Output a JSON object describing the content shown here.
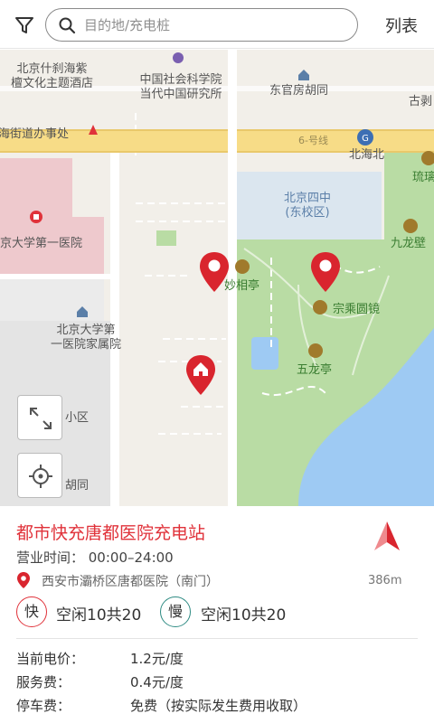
{
  "search": {
    "placeholder": "目的地/充电桩"
  },
  "header": {
    "list_label": "列表"
  },
  "map": {
    "labels": {
      "shichahai": "北京什刹海紫\n檀文化主题酒店",
      "cass": "中国社会科学院\n当代中国研究所",
      "dongguanfang": "东官房胡同",
      "guyi": "古剥",
      "street_office": "海街道办事处",
      "ring_road": "6-号线",
      "beihaibei": "北海北",
      "school": "北京四中\n(东校区)",
      "liuli": "琉璃",
      "hospital": "京大学第一医院",
      "jiulongbi": "九龙壁",
      "miaoxiang": "妙相亭",
      "zongcheng": "宗乘圆镜",
      "dorm": "北京大学第\n一医院家属院",
      "wulong": "五龙亭",
      "xiaoqu": "小区",
      "hutong": "胡同"
    },
    "accent_red": "#e0323a",
    "park_green": "#b9dca4",
    "lake_blue": "#9ecaf3"
  },
  "station": {
    "name": "都市快充唐都医院充电站",
    "hours": "营业时间：  00:00–24:00",
    "address": "西安市灞桥区唐都医院（南门）",
    "distance": "386m",
    "fast_badge": "快",
    "fast_status": "空闲10共20",
    "slow_badge": "慢",
    "slow_status": "空闲10共20",
    "electricity_label": "当前电价：",
    "electricity_value": "1.2元/度",
    "service_label": "服务费：",
    "service_value": "0.4元/度",
    "parking_label": "停车费：",
    "parking_value": "免费（按实际发生费用收取）"
  }
}
